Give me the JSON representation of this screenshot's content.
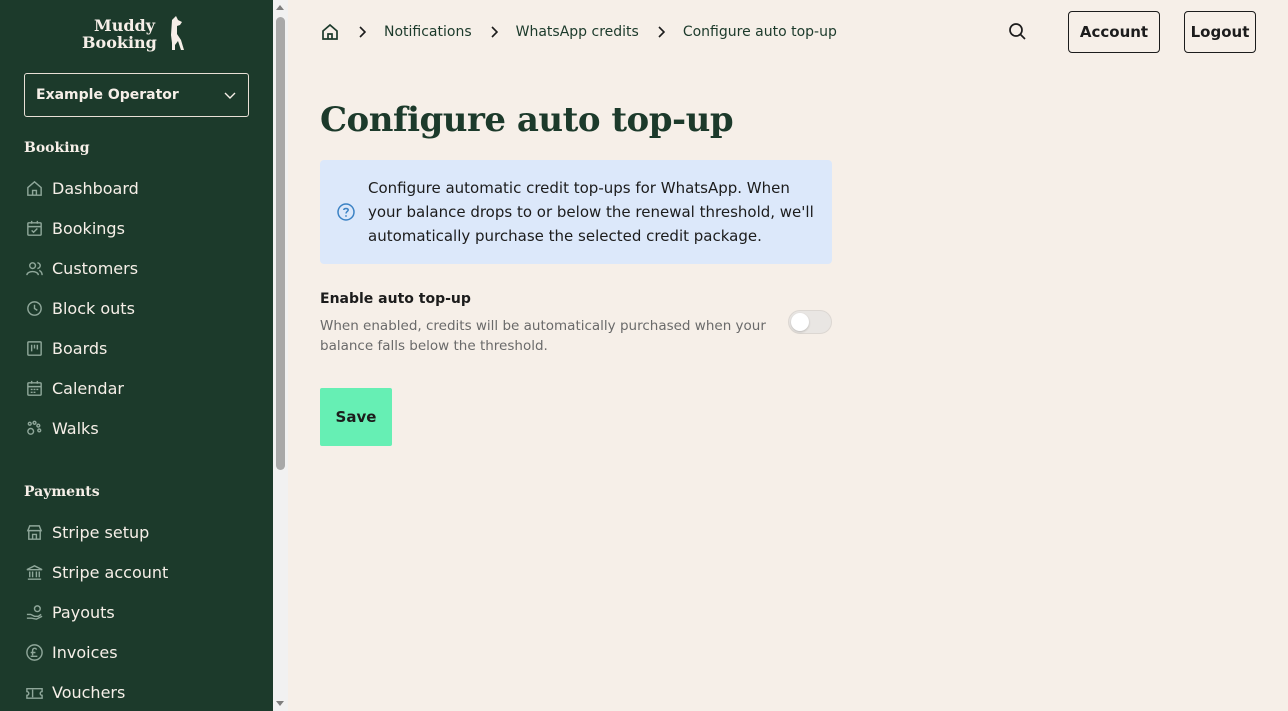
{
  "brand": {
    "logo_line1": "Muddy",
    "logo_line2": "Booking"
  },
  "operator_select": {
    "value": "Example Operator"
  },
  "sidebar": {
    "sections": [
      {
        "title": "Booking",
        "items": [
          {
            "label": "Dashboard",
            "icon": "home-icon"
          },
          {
            "label": "Bookings",
            "icon": "calendar-check-icon"
          },
          {
            "label": "Customers",
            "icon": "users-icon"
          },
          {
            "label": "Block outs",
            "icon": "clock-icon"
          },
          {
            "label": "Boards",
            "icon": "board-icon"
          },
          {
            "label": "Calendar",
            "icon": "calendar-icon"
          },
          {
            "label": "Walks",
            "icon": "paw-icon"
          }
        ]
      },
      {
        "title": "Payments",
        "items": [
          {
            "label": "Stripe setup",
            "icon": "store-icon"
          },
          {
            "label": "Stripe account",
            "icon": "bank-icon"
          },
          {
            "label": "Payouts",
            "icon": "payout-icon"
          },
          {
            "label": "Invoices",
            "icon": "pound-icon"
          },
          {
            "label": "Vouchers",
            "icon": "ticket-icon"
          }
        ]
      }
    ]
  },
  "breadcrumb": {
    "items": [
      "Notifications",
      "WhatsApp credits",
      "Configure auto top-up"
    ]
  },
  "header": {
    "account_label": "Account",
    "logout_label": "Logout"
  },
  "main": {
    "title": "Configure auto top-up",
    "info": "Configure automatic credit top-ups for WhatsApp. When your balance drops to or below the renewal threshold, we'll automatically purchase the selected credit package.",
    "toggle_label": "Enable auto top-up",
    "toggle_description": "When enabled, credits will be automatically purchased when your balance falls below the threshold.",
    "toggle_enabled": false,
    "save_label": "Save"
  },
  "colors": {
    "sidebar_bg": "#1c3a2b",
    "page_bg": "#f6efe8",
    "info_bg": "#dce8fa",
    "save_bg": "#66efb4",
    "accent_blue": "#3b82c4"
  }
}
